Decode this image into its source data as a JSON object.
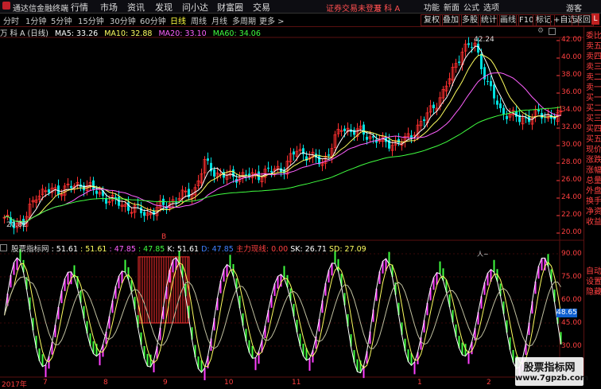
{
  "app": {
    "title": "通达信金融终端",
    "notice": "证券交易未登录",
    "stock": "万 科 A",
    "guest": "游客"
  },
  "menu": [
    "行情",
    "市场",
    "资讯",
    "发现",
    "问小达",
    "财富圈",
    "交易"
  ],
  "top_right": [
    "功能",
    "新面",
    "公式",
    "选项"
  ],
  "periods": [
    "分时",
    "1分钟",
    "5分钟",
    "15分钟",
    "30分钟",
    "60分钟",
    "日线",
    "周线",
    "月线",
    "多周期",
    "更多 >"
  ],
  "active_period": "日线",
  "tools": [
    "复权",
    "叠加",
    "多股",
    "统计",
    "画线",
    "F10",
    "标记",
    "+自选",
    "返回"
  ],
  "main_info": {
    "name": "万 科 A (日线)",
    "ma5": "MA5: 33.26",
    "ma10": "MA10: 32.88",
    "ma20": "MA20: 33.10",
    "ma60": "MA60: 34.06"
  },
  "price_axis": [
    "42.00",
    "40.00",
    "38.00",
    "36.00",
    "34.00",
    "32.00",
    "30.00",
    "28.00",
    "26.00",
    "24.00",
    "22.00",
    "20.00"
  ],
  "price_marks": {
    "high": "42.24",
    "low": "20.82",
    "marker": "B"
  },
  "ind_info": {
    "name": "股票指标网",
    "v1": ": 51.61",
    "v2": ": 51.61",
    "v3": ": 47.85",
    "v4": ": 47.85",
    "k": "K: 51.61",
    "d": "D: 47.85",
    "zl": "主力现线: 0.00",
    "sk": "SK: 26.71",
    "sd": "SD: 27.09"
  },
  "ind_axis": [
    "90.00",
    "75.00",
    "60.00",
    "45.00",
    "30.00"
  ],
  "ind_current": "48.65",
  "ind_top_label": "人~",
  "right_panel": [
    "委比",
    "卖五",
    "卖四",
    "卖三",
    "卖二",
    "卖一",
    "买一",
    "买二",
    "买三",
    "买四",
    "买五",
    "现价",
    "涨跌",
    "涨幅",
    "总量",
    "外盘",
    "换手",
    "净资",
    "收益"
  ],
  "right_panel_bottom": [
    "自动",
    "设置",
    "隐藏"
  ],
  "x_labels": [
    "2017年",
    "7",
    "8",
    "9",
    "10",
    "11",
    "1",
    "2"
  ],
  "watermark": {
    "name": "股票指标网",
    "url": "www.7gpzb.com"
  },
  "colors": {
    "up": "#ff3030",
    "down": "#00e0e0",
    "ma5": "#ffffff",
    "ma10": "#ffff60",
    "ma20": "#ff60ff",
    "ma60": "#40ff40",
    "kd_pos": "#ff40ff",
    "kd_neg": "#40ff40"
  }
}
